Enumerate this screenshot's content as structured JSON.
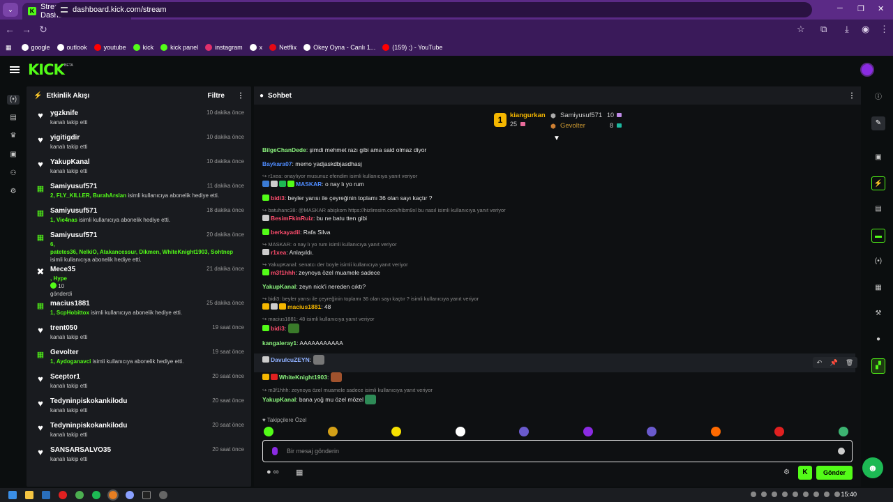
{
  "browser": {
    "tab_title": "Stream - Kick Dashboard",
    "url": "dashboard.kick.com/stream",
    "bookmarks": [
      {
        "label": "google",
        "icon": "google-icon",
        "color": "#ffffff"
      },
      {
        "label": "outlook",
        "icon": "globe-icon",
        "color": "#ffffff"
      },
      {
        "label": "youtube",
        "icon": "youtube-icon",
        "color": "#ff0000"
      },
      {
        "label": "kick",
        "icon": "kick-icon",
        "color": "#53fc18"
      },
      {
        "label": "kick panel",
        "icon": "kick-icon",
        "color": "#53fc18"
      },
      {
        "label": "instagram",
        "icon": "instagram-icon",
        "color": "#e1306c"
      },
      {
        "label": "x",
        "icon": "x-icon",
        "color": "#ffffff"
      },
      {
        "label": "Netflix",
        "icon": "netflix-icon",
        "color": "#e50914"
      },
      {
        "label": "Okey Oyna - Canlı 1...",
        "icon": "okey-icon",
        "color": "#ffffff"
      },
      {
        "label": "(159) ;) - YouTube",
        "icon": "youtube-icon",
        "color": "#ff0000"
      }
    ]
  },
  "brand": {
    "logo": "KICK",
    "beta": "BETA",
    "accent": "#53fc18"
  },
  "activity": {
    "title": "Etkinlik Akışı",
    "filter": "Filtre",
    "events": [
      {
        "name": "ygzknife",
        "time": "10 dakika önce",
        "type": "follow",
        "text": "kanalı takip etti"
      },
      {
        "name": "yigitigdir",
        "time": "10 dakika önce",
        "type": "follow",
        "text": "kanalı takip etti"
      },
      {
        "name": "YakupKanal",
        "time": "10 dakika önce",
        "type": "follow",
        "text": "kanalı takip etti"
      },
      {
        "name": "Samiyusuf571",
        "time": "11 dakika önce",
        "type": "gift",
        "count": "2,",
        "recipients": "FLY_KILLER, BurahArslan",
        "text": "isimli kullanıcıya abonelik hediye etti."
      },
      {
        "name": "Samiyusuf571",
        "time": "18 dakika önce",
        "type": "gift",
        "count": "1,",
        "recipients": "Vie4nas",
        "text": "isimli kullanıcıya abonelik hediye etti."
      },
      {
        "name": "Samiyusuf571",
        "time": "20 dakika önce",
        "type": "gift3",
        "count": "6,",
        "recipients": "patetes36, NelkiO, Atakancessur, Dikmen, WhiteKnight1903, Sohtnep",
        "text": "isimli kullanıcıya abonelik hediye etti."
      },
      {
        "name": "Mece35",
        "time": "21 dakika önce",
        "type": "kicks",
        "line1": ", Hype",
        "amount": "10",
        "text": "gönderdi"
      },
      {
        "name": "macius1881",
        "time": "25 dakika önce",
        "type": "gift",
        "count": "1,",
        "recipients": "ScpHobittox",
        "text": "isimli kullanıcıya abonelik hediye etti."
      },
      {
        "name": "trent050",
        "time": "19 saat önce",
        "type": "follow",
        "text": "kanalı takip etti"
      },
      {
        "name": "Gevolter",
        "time": "19 saat önce",
        "type": "gift",
        "count": "1,",
        "recipients": "Aydoganavci",
        "text": "isimli kullanıcıya abonelik hediye etti."
      },
      {
        "name": "Sceptor1",
        "time": "20 saat önce",
        "type": "follow",
        "text": "kanalı takip etti"
      },
      {
        "name": "Tedyninpiskokankilodu",
        "time": "20 saat önce",
        "type": "follow",
        "text": "kanalı takip etti"
      },
      {
        "name": "Tedyninpiskokankilodu",
        "time": "20 saat önce",
        "type": "follow",
        "text": "kanalı takip etti"
      },
      {
        "name": "SANSARSALVO35",
        "time": "20 saat önce",
        "type": "follow",
        "text": "kanalı takip etti"
      }
    ]
  },
  "chat": {
    "title": "Sohbet",
    "leaderboard": {
      "first": {
        "rank": "1",
        "name": "kiangurkan",
        "value": "25"
      },
      "second": {
        "name": "Samiyusuf571",
        "value": "10"
      },
      "third": {
        "name": "Gevolter",
        "value": "8"
      }
    },
    "messages": [
      {
        "user": "BilgeChanDede",
        "color": "#8cf57f",
        "text": ": şimdi mehmet razı gibi ama said olmaz diyor"
      },
      {
        "user": "Baykara07",
        "color": "#4f8cff",
        "text": ": memo yadjaskdbjasdhasj"
      },
      {
        "reply": "r1xea: onaylıyor musunuz efendim isimli kullanıcıya yanıt veriyor",
        "badges": [
          "#3a7bd5",
          "#cccccc",
          "#1db954",
          "#53fc18"
        ],
        "user": "MASKAR",
        "color": "#4f8cff",
        "text": ": o nay lı yo rum"
      },
      {
        "badges": [
          "#53fc18"
        ],
        "user": "bidi3",
        "color": "#ff4d6d",
        "text": ": beyler yarısı ile çeyreğinin toplamı 36 olan sayı kaçtır ?"
      },
      {
        "reply": "batuhanc38: @MASKAR abişkom https://hizliresim.com/hibm9xl bu nasıl isimli kullanıcıya yanıt veriyor",
        "badges": [
          "#cccccc"
        ],
        "user": "BesimFkinRuiz",
        "color": "#ff4d6d",
        "text": ": bu ne batu tten gibi"
      },
      {
        "badges": [
          "#53fc18"
        ],
        "user": "berkayadil",
        "color": "#ff4d6d",
        "text": ": Rafa Silva"
      },
      {
        "reply": "MASKAR: o nay lı yo rum isimli kullanıcıya yanıt veriyor",
        "badges": [
          "#cccccc"
        ],
        "user": "r1xea",
        "color": "#ff4d6d",
        "text": ": Anlaşıldı."
      },
      {
        "reply": "YakupKanal: senatcı der boyle isimli kullanıcıya yanıt veriyor",
        "badges": [
          "#53fc18"
        ],
        "user": "m3f1hhh",
        "color": "#ff4d6d",
        "text": ": zeynoya özel muamele sadece"
      },
      {
        "user": "YakupKanal",
        "color": "#8cf57f",
        "text": ": zeyn nick'i nereden cıktı?"
      },
      {
        "reply": "bidi3: beyler yarısı ile çeyreğinin toplamı 36 olan sayı kaçtır ? isimli kullanıcıya yanıt veriyor",
        "badges": [
          "#f5b700",
          "#cccccc",
          "#f5b700"
        ],
        "user": "macius1881",
        "color": "#f5b700",
        "text": ": 48"
      },
      {
        "reply": "macius1881: 48 isimli kullanıcıya yanıt veriyor",
        "badges": [
          "#53fc18"
        ],
        "user": "bidi3",
        "color": "#ff4d6d",
        "text": ":",
        "emote": "#3a7a2a"
      },
      {
        "user": "kangaleray1",
        "color": "#8cf57f",
        "text": ": AAAAAAAAAAA"
      },
      {
        "badges": [
          "#cccccc"
        ],
        "user": "DavulcuZEYN",
        "color": "#8fb0ff",
        "text": ":",
        "emote": "#777777",
        "highlight": true
      },
      {
        "badges": [
          "#f5b700",
          "#e02020"
        ],
        "user": "WhiteKnight1903",
        "color": "#8cf57f",
        "text": ":",
        "emote": "#a0522d"
      },
      {
        "reply": "m3f1hhh: zeynoya özel muamele sadece isimli kullanıcıya yanıt veriyor",
        "user": "YakupKanal",
        "color": "#8cf57f",
        "text": ": bana yoğ mu özel mözel",
        "emote": "#2e8b57"
      }
    ],
    "followers_only": "Takipçilere Özel",
    "emote_colors": [
      "#53fc18",
      "#d4a017",
      "#f5e000",
      "#ffffff",
      "#6a5acd",
      "#8a2be2",
      "#6a5acd",
      "#ff6a00",
      "#e02020",
      "#3cb371"
    ],
    "input_placeholder": "Bir mesaj gönderin",
    "send": "Gönder"
  },
  "taskbar": {
    "time": "15:40"
  }
}
